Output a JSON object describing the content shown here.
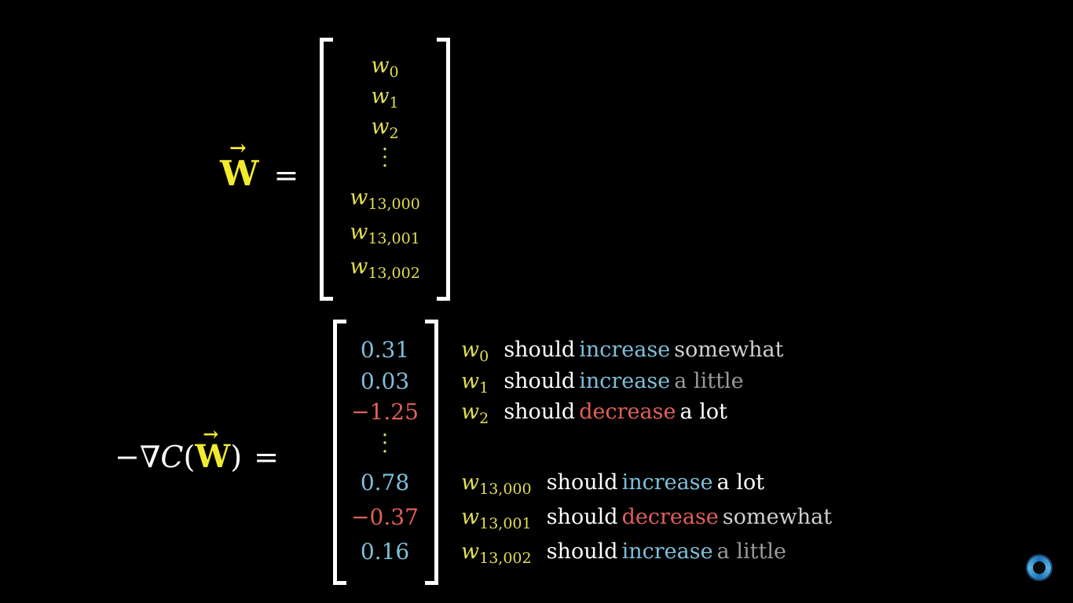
{
  "equation_top": {
    "lhs_vector": "W",
    "lhs_arrow": "⃗",
    "equals": "=",
    "entries": [
      {
        "base": "w",
        "sub": "0"
      },
      {
        "base": "w",
        "sub": "1"
      },
      {
        "base": "w",
        "sub": "2"
      },
      {
        "base": "",
        "sub": ""
      },
      {
        "base": "w",
        "sub": "13,000"
      },
      {
        "base": "w",
        "sub": "13,001"
      },
      {
        "base": "w",
        "sub": "13,002"
      }
    ],
    "vdots": "⋮"
  },
  "equation_bottom": {
    "minus": "−",
    "nabla": "∇",
    "C": "C",
    "open_paren": "(",
    "vec": "W",
    "close_paren": ")",
    "equals": "=",
    "values": [
      "0.31",
      "0.03",
      "−1.25",
      "⋮",
      "0.78",
      "−0.37",
      "0.16"
    ],
    "value_colors": [
      "blue",
      "blue",
      "red",
      "yellow",
      "blue",
      "red",
      "blue"
    ]
  },
  "annotations": [
    {
      "var": "w",
      "sub": "0",
      "should": "should",
      "verb": "increase",
      "verb_color": "blue",
      "amount": "somewhat",
      "amount_color": "grey-light"
    },
    {
      "var": "w",
      "sub": "1",
      "should": "should",
      "verb": "increase",
      "verb_color": "blue",
      "amount": "a little",
      "amount_color": "grey"
    },
    {
      "var": "w",
      "sub": "2",
      "should": "should",
      "verb": "decrease",
      "verb_color": "red",
      "amount": "a lot",
      "amount_color": "white"
    },
    {
      "var": "w",
      "sub": "13,000",
      "should": "should",
      "verb": "increase",
      "verb_color": "blue",
      "amount": "a lot",
      "amount_color": "white"
    },
    {
      "var": "w",
      "sub": "13,001",
      "should": "should",
      "verb": "decrease",
      "verb_color": "red",
      "amount": "somewhat",
      "amount_color": "grey-light"
    },
    {
      "var": "w",
      "sub": "13,002",
      "should": "should",
      "verb": "increase",
      "verb_color": "blue",
      "amount": "a little",
      "amount_color": "grey"
    }
  ],
  "colors": {
    "background": "#000000",
    "variable_yellow": "#e3de55",
    "vector_yellow": "#f2ea2e",
    "increase_blue": "#7fbfda",
    "decrease_red": "#e0605a",
    "text_white": "#ffffff",
    "text_grey": "#9a9a9a"
  },
  "icons": {
    "channel_badge": "channel-logo-icon"
  }
}
